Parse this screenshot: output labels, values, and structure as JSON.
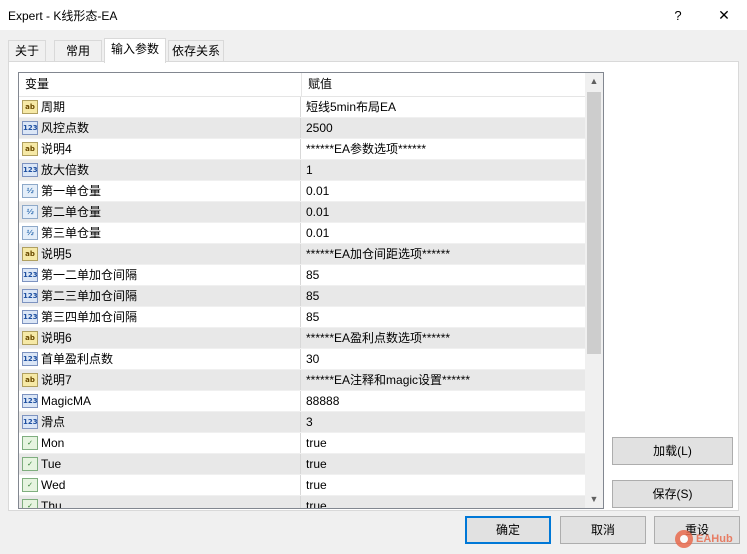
{
  "window": {
    "title": "Expert - K线形态-EA",
    "help_glyph": "?",
    "close_glyph": "✕"
  },
  "tabs": [
    {
      "label": "关于"
    },
    {
      "label": "常用"
    },
    {
      "label": "输入参数"
    },
    {
      "label": "依存关系"
    }
  ],
  "grid": {
    "col_variable": "变量",
    "col_value": "赋值",
    "rows": [
      {
        "type": "ab",
        "name": "周期",
        "value": "短线5min布局EA"
      },
      {
        "type": "123",
        "name": "风控点数",
        "value": "2500"
      },
      {
        "type": "ab",
        "name": "说明4",
        "value": "******EA参数选项******"
      },
      {
        "type": "123",
        "name": "放大倍数",
        "value": "1"
      },
      {
        "type": "1/2",
        "name": "第一单仓量",
        "value": "0.01"
      },
      {
        "type": "1/2",
        "name": "第二单仓量",
        "value": "0.01"
      },
      {
        "type": "1/2",
        "name": "第三单仓量",
        "value": "0.01"
      },
      {
        "type": "ab",
        "name": "说明5",
        "value": "******EA加仓间距选项******"
      },
      {
        "type": "123",
        "name": "第一二单加仓间隔",
        "value": "85"
      },
      {
        "type": "123",
        "name": "第二三单加仓间隔",
        "value": "85"
      },
      {
        "type": "123",
        "name": "第三四单加仓间隔",
        "value": "85"
      },
      {
        "type": "ab",
        "name": "说明6",
        "value": "******EA盈利点数选项******"
      },
      {
        "type": "123",
        "name": "首单盈利点数",
        "value": "30"
      },
      {
        "type": "ab",
        "name": "说明7",
        "value": "******EA注释和magic设置******"
      },
      {
        "type": "123",
        "name": "MagicMA",
        "value": "88888"
      },
      {
        "type": "123",
        "name": "滑点",
        "value": "3"
      },
      {
        "type": "bool",
        "name": "Mon",
        "value": "true"
      },
      {
        "type": "bool",
        "name": "Tue",
        "value": "true"
      },
      {
        "type": "bool",
        "name": "Wed",
        "value": "true"
      },
      {
        "type": "bool",
        "name": "Thu",
        "value": "true"
      }
    ]
  },
  "buttons": {
    "load": "加载(L)",
    "save": "保存(S)",
    "ok": "确定",
    "cancel": "取消",
    "reset": "重设"
  },
  "watermark": {
    "text": "EAHub"
  },
  "colors": {
    "accent": "#0078d7",
    "row_alt": "#e8e8e8",
    "button_face": "#e1e1e1"
  }
}
